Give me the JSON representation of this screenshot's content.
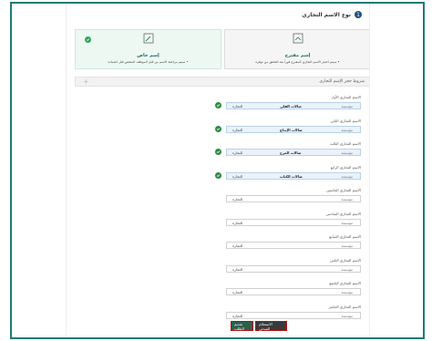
{
  "section": {
    "number": "1",
    "title": "نوع الاسم التجاري"
  },
  "cards": {
    "suggested": {
      "title": "إسم مقترح",
      "desc": "• سيتم اختيار الاسم التجاري المقترح فوراً بعد التحقق من توفره"
    },
    "custom": {
      "title": "إسم خاص",
      "desc": "• سيتم مراجعة الاسم من قبل الموظف المختص قبل اعتماده"
    }
  },
  "conditions": {
    "title": "شروط حجز الإسم التجاري"
  },
  "names": [
    {
      "label": "الاسم التجاري الأول",
      "entity": "مؤسسة",
      "value": "صالات القلي",
      "suffix": "للتجارة",
      "filled": true
    },
    {
      "label": "الاسم التجاري الثاني",
      "entity": "مؤسسة",
      "value": "صالات الإبداع",
      "suffix": "للتجارة",
      "filled": true
    },
    {
      "label": "الاسم التجاري الثالث",
      "entity": "مؤسسة",
      "value": "صالات المرح",
      "suffix": "للتجارة",
      "filled": true
    },
    {
      "label": "الاسم التجاري الرابع",
      "entity": "مؤسسة",
      "value": "صالات الكتاب",
      "suffix": "للتجارة",
      "filled": true
    },
    {
      "label": "الاسم التجاري الخامس",
      "entity": "مؤسسة",
      "value": "",
      "suffix": "للتجارة",
      "filled": false
    },
    {
      "label": "الاسم التجاري السادس",
      "entity": "مؤسسة",
      "value": "",
      "suffix": "للتجارة",
      "filled": false
    },
    {
      "label": "الاسم التجاري السابع",
      "entity": "مؤسسة",
      "value": "",
      "suffix": "للتجارة",
      "filled": false
    },
    {
      "label": "الاسم التجاري الثامن",
      "entity": "مؤسسة",
      "value": "",
      "suffix": "للتجارة",
      "filled": false
    },
    {
      "label": "الاسم التجاري التاسع",
      "entity": "مؤسسة",
      "value": "",
      "suffix": "للتجارة",
      "filled": false
    },
    {
      "label": "الاسم التجاري العاشر",
      "entity": "مؤسسة",
      "value": "",
      "suffix": "للتجارة",
      "filled": false
    }
  ],
  "buttons": {
    "submit": "الاستعلام المبدئي",
    "preview": "تقديم الطلب"
  },
  "colors": {
    "accent": "#1f7a78",
    "check": "#2b8a3e"
  }
}
